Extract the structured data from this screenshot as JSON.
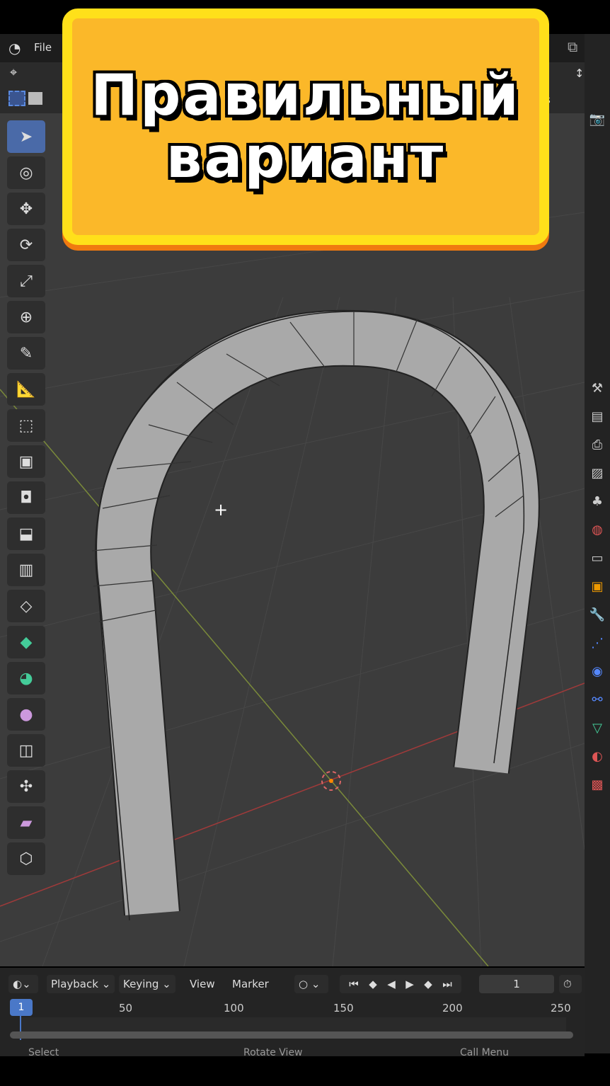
{
  "overlay": {
    "line1": "Правильный",
    "line2": "вариант"
  },
  "menu": {
    "file": "File"
  },
  "header": {
    "mode_suffix": "s"
  },
  "toolbar": [
    "select-box",
    "cursor",
    "move",
    "rotate",
    "scale",
    "transform",
    "annotate",
    "measure",
    "add-cube",
    "extrude",
    "inset",
    "bevel",
    "loop-cut",
    "knife",
    "poly-build",
    "spin",
    "smooth",
    "edge-slide",
    "shrink-fatten",
    "shear",
    "rip"
  ],
  "right_icons": [
    "tool",
    "render",
    "output",
    "view-layer",
    "scene",
    "world",
    "collection",
    "object",
    "modifier",
    "particles",
    "physics",
    "constraints",
    "data",
    "material",
    "texture"
  ],
  "timeline": {
    "playback": "Playback",
    "keying": "Keying",
    "view": "View",
    "marker": "Marker",
    "current_frame": "1",
    "frame_badge": "1",
    "ticks": [
      "50",
      "100",
      "150",
      "200",
      "250"
    ]
  },
  "status": {
    "select": "Select",
    "rotate": "Rotate View",
    "menu": "Call Menu"
  }
}
